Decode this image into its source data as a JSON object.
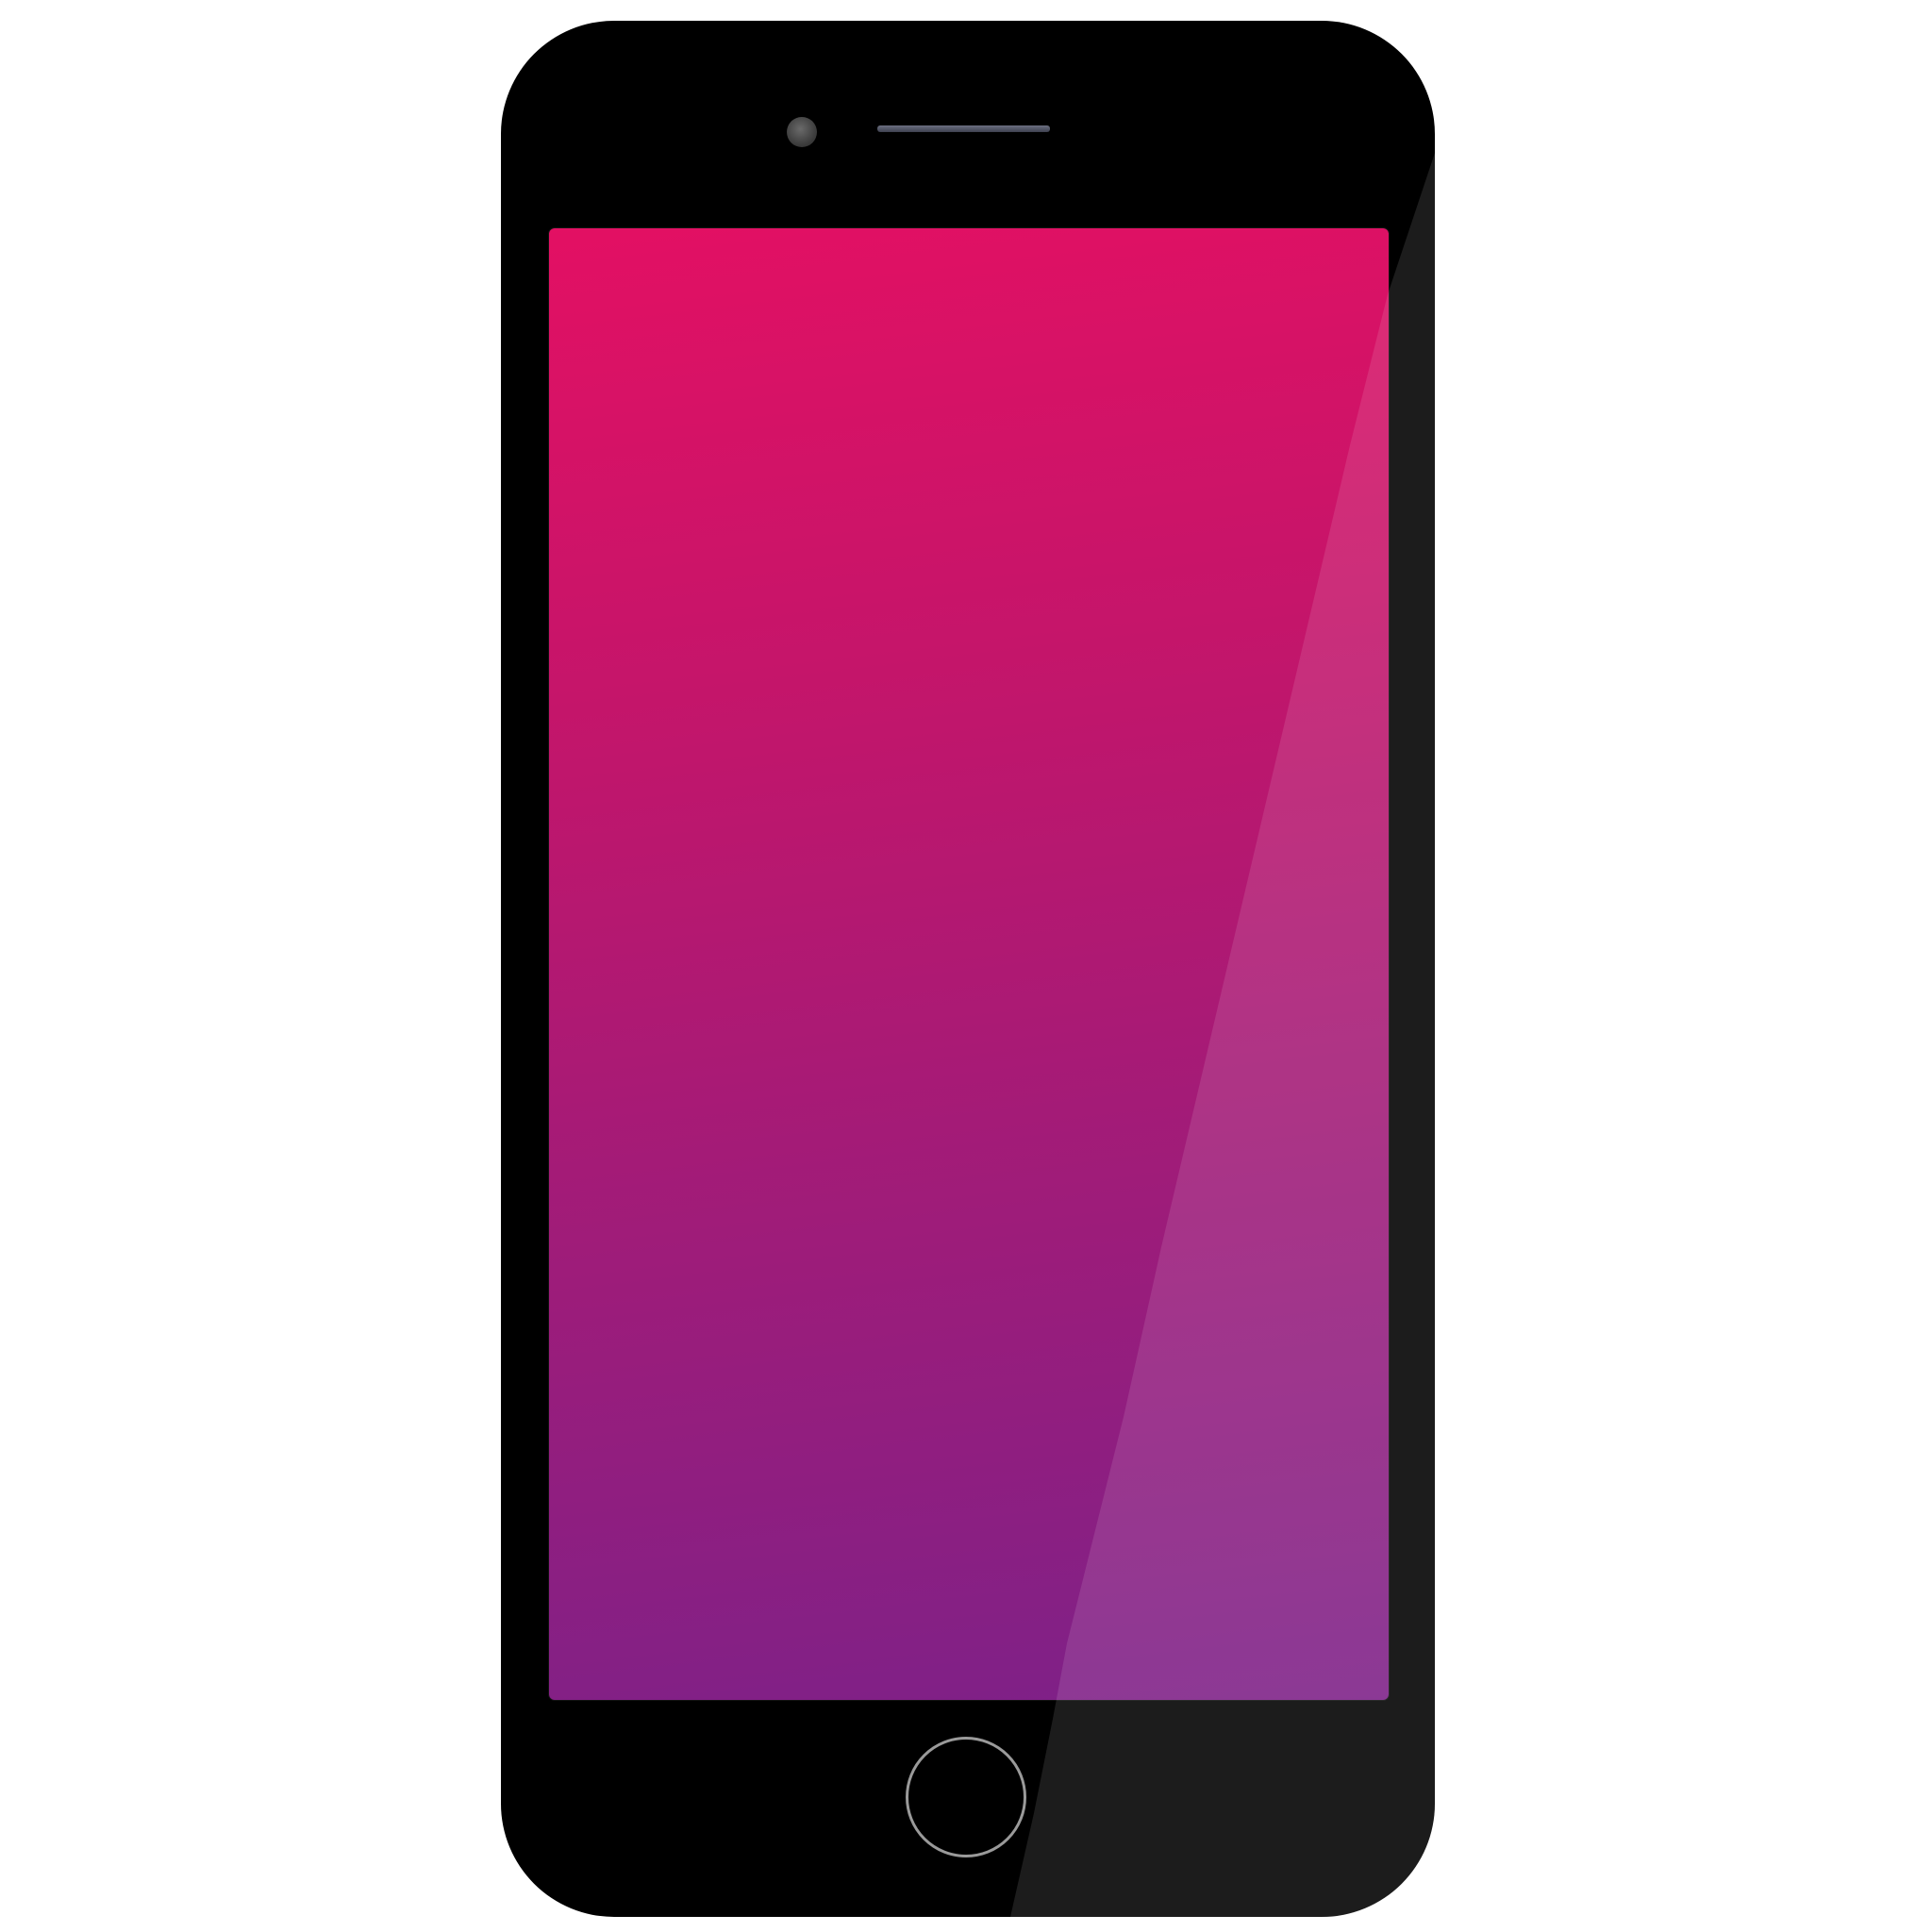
{
  "device": {
    "type": "smartphone",
    "frame_color": "#000000",
    "screen_gradient": [
      "#e31063",
      "#c5156a",
      "#a41b77",
      "#7d2188"
    ],
    "icons": {
      "camera": "front-camera-icon",
      "speaker": "earpiece-speaker-icon",
      "home": "home-button"
    }
  }
}
